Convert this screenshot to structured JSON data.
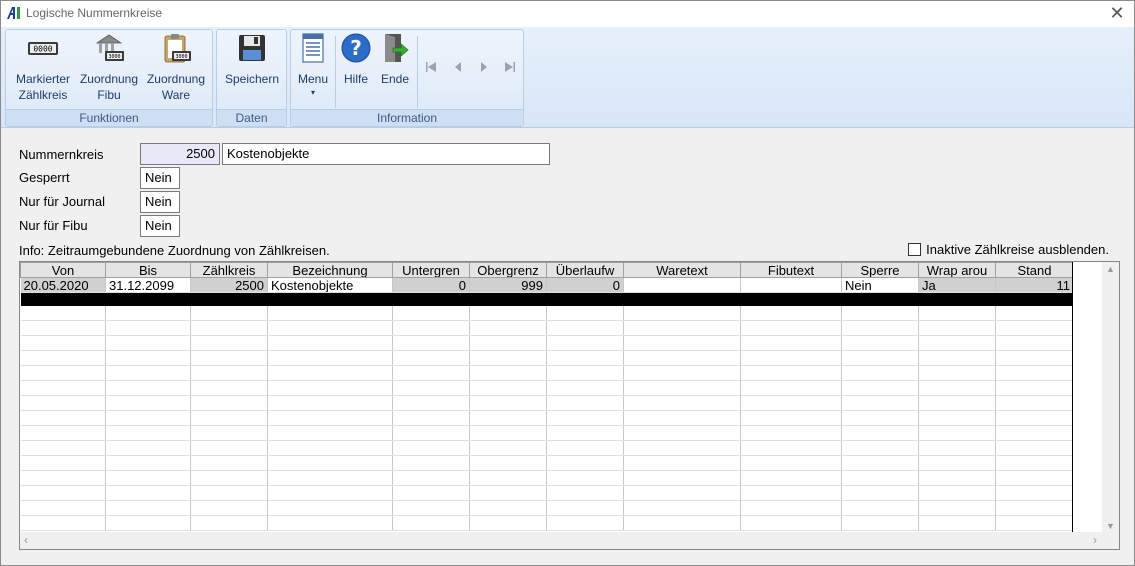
{
  "window": {
    "title": "Logische Nummernkreise"
  },
  "ribbon": {
    "groups": [
      {
        "label": "Funktionen"
      },
      {
        "label": "Daten"
      },
      {
        "label": "Information"
      }
    ],
    "buttons": {
      "markierter_zaehlkreis": "Markierter\nZählkreis",
      "zuordnung_fibu": "Zuordnung\nFibu",
      "zuordnung_ware": "Zuordnung\nWare",
      "speichern": "Speichern",
      "menu": "Menu",
      "hilfe": "Hilfe",
      "ende": "Ende"
    },
    "counter_text": "0000",
    "counter_small": "3000"
  },
  "form": {
    "nummernkreis_label": "Nummernkreis",
    "nummernkreis_value": "2500",
    "nummernkreis_name": "Kostenobjekte",
    "gesperrt_label": "Gesperrt",
    "gesperrt_value": "Nein",
    "journal_label": "Nur für Journal",
    "journal_value": "Nein",
    "fibu_label": "Nur für Fibu",
    "fibu_value": "Nein"
  },
  "info": {
    "text": "Info: Zeitraumgebundene Zuordnung von Zählkreisen.",
    "checkbox_label": "Inaktive Zählkreise ausblenden."
  },
  "grid": {
    "columns": [
      "Von",
      "Bis",
      "Zählkreis",
      "Bezeichnung",
      "Untergren",
      "Obergrenz",
      "Überlaufw",
      "Waretext",
      "Fibutext",
      "Sperre",
      "Wrap arou",
      "Stand"
    ],
    "rows": [
      [
        "20.05.2020",
        "31.12.2099",
        "2500",
        "Kostenobjekte",
        "0",
        "999",
        "0",
        "",
        "",
        "Nein",
        "Ja",
        "11"
      ]
    ]
  },
  "colors": {
    "ribbon_text": "#1f3c6a",
    "group_label": "#3c5a86",
    "field_num_bg": "#e8e8f8"
  }
}
